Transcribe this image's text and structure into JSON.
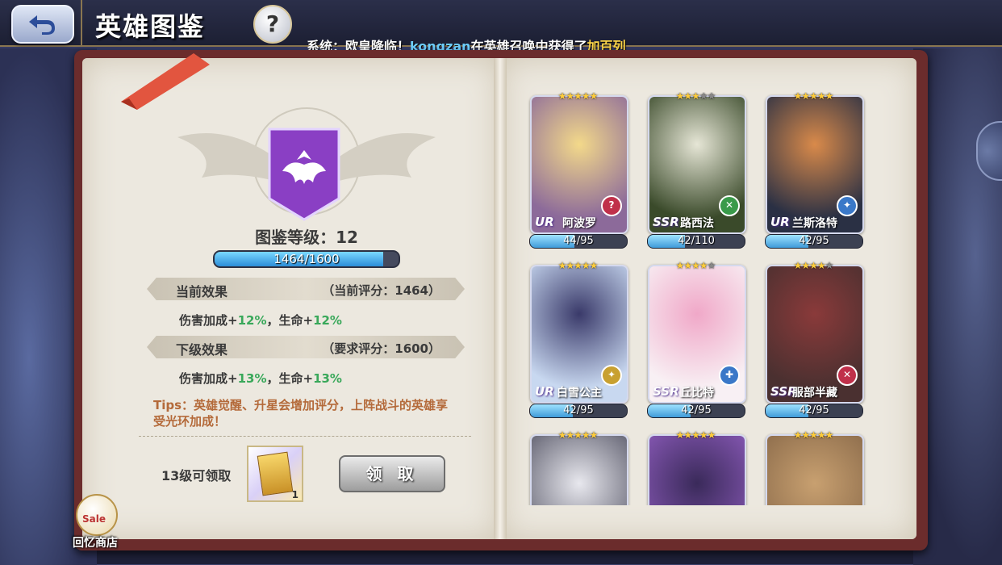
{
  "header": {
    "title": "英雄图鉴",
    "help_label": "?"
  },
  "announcement": {
    "prefix": "系统：欧皇降临！",
    "user": "kongzan",
    "middle": "在英雄召唤中获得了",
    "hero": "加百列"
  },
  "codex": {
    "level_label": "图鉴等级：12",
    "progress_text": "1464/1600",
    "progress_value": 1464,
    "progress_max": 1600,
    "current_header": "当前效果",
    "current_score": "（当前评分：1464）",
    "current_effect": {
      "dmg_label": "伤害加成+",
      "dmg_val": "12%",
      "sep": "，生命+",
      "hp_val": "12%"
    },
    "next_header": "下级效果",
    "next_score": "（要求评分：1600）",
    "next_effect": {
      "dmg_label": "伤害加成+",
      "dmg_val": "13%",
      "sep": "，生命+",
      "hp_val": "13%"
    },
    "tips": "Tips：英雄觉醒、升星会增加评分，上阵战斗的英雄享受光环加成！",
    "reward_label": "13级可领取",
    "reward_qty": "1",
    "claim_button": "领 取"
  },
  "shop": {
    "badge": "Sale",
    "label": "回忆商店"
  },
  "heroes": [
    {
      "name": "阿波罗",
      "rank": "UR",
      "stars": 5,
      "max_stars": 5,
      "progress": "44/95",
      "ratio": 0.46,
      "class": "?",
      "class_color": "#c0304a",
      "art": [
        "#f3d98a",
        "#8c6a9a"
      ]
    },
    {
      "name": "路西法",
      "rank": "SSR",
      "stars": 3,
      "max_stars": 5,
      "progress": "42/110",
      "ratio": 0.38,
      "class": "✕",
      "class_color": "#3a9a4a",
      "art": [
        "#e6e6d6",
        "#3a4a2a"
      ]
    },
    {
      "name": "兰斯洛特",
      "rank": "UR",
      "stars": 5,
      "max_stars": 5,
      "progress": "42/95",
      "ratio": 0.44,
      "class": "✦",
      "class_color": "#3a78c8",
      "art": [
        "#d98a4a",
        "#2a3044"
      ]
    },
    {
      "name": "白雪公主",
      "rank": "UR",
      "stars": 5,
      "max_stars": 5,
      "progress": "42/95",
      "ratio": 0.44,
      "class": "✦",
      "class_color": "#c8a030",
      "art": [
        "#3a3a6a",
        "#c8d8f0"
      ]
    },
    {
      "name": "丘比特",
      "rank": "SSR",
      "stars": 4,
      "max_stars": 5,
      "progress": "42/95",
      "ratio": 0.44,
      "class": "✚",
      "class_color": "#3a78c8",
      "art": [
        "#f0a8c8",
        "#f8f0f4"
      ]
    },
    {
      "name": "服部半藏",
      "rank": "SSR",
      "stars": 4,
      "max_stars": 5,
      "progress": "42/95",
      "ratio": 0.44,
      "class": "✕",
      "class_color": "#c0304a",
      "art": [
        "#8a3a3a",
        "#4a3030"
      ]
    },
    {
      "name": "",
      "rank": "",
      "stars": 5,
      "max_stars": 5,
      "progress": "",
      "ratio": 0,
      "class": "",
      "class_color": "#888",
      "art": [
        "#e8e8ee",
        "#5a5a6a"
      ]
    },
    {
      "name": "",
      "rank": "",
      "stars": 5,
      "max_stars": 5,
      "progress": "",
      "ratio": 0,
      "class": "",
      "class_color": "#888",
      "art": [
        "#3a2a5a",
        "#8a5ab8"
      ]
    },
    {
      "name": "",
      "rank": "",
      "stars": 5,
      "max_stars": 5,
      "progress": "",
      "ratio": 0,
      "class": "",
      "class_color": "#888",
      "art": [
        "#c8a070",
        "#8a6a4a"
      ]
    }
  ]
}
